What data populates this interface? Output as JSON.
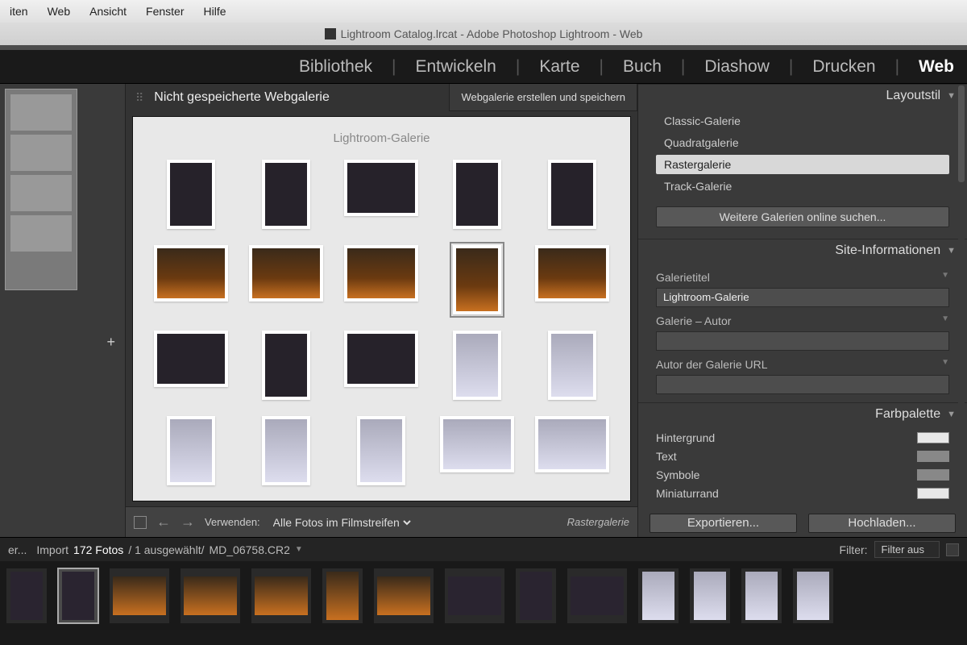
{
  "menubar": [
    "iten",
    "Web",
    "Ansicht",
    "Fenster",
    "Hilfe"
  ],
  "title": "Lightroom Catalog.lrcat - Adobe Photoshop Lightroom - Web",
  "modules": [
    "Bibliothek",
    "Entwickeln",
    "Karte",
    "Buch",
    "Diashow",
    "Drucken",
    "Web"
  ],
  "modules_active": "Web",
  "center": {
    "header_title": "Nicht gespeicherte Webgalerie",
    "save_btn": "Webgalerie erstellen und speichern",
    "gallery_title": "Lightroom-Galerie"
  },
  "thumbs": [
    {
      "o": "p",
      "cls": "dark"
    },
    {
      "o": "p",
      "cls": "dark"
    },
    {
      "o": "l",
      "cls": "dark"
    },
    {
      "o": "p",
      "cls": "dark"
    },
    {
      "o": "p",
      "cls": "dark"
    },
    {
      "o": "l",
      "cls": "fire"
    },
    {
      "o": "l",
      "cls": "fire"
    },
    {
      "o": "l",
      "cls": "fire"
    },
    {
      "o": "p",
      "cls": "fire",
      "sel": true
    },
    {
      "o": "l",
      "cls": "fire"
    },
    {
      "o": "l",
      "cls": "dark"
    },
    {
      "o": "p",
      "cls": "dark"
    },
    {
      "o": "l",
      "cls": "dark"
    },
    {
      "o": "p",
      "cls": "white"
    },
    {
      "o": "p",
      "cls": "white"
    },
    {
      "o": "p",
      "cls": "white"
    },
    {
      "o": "p",
      "cls": "white"
    },
    {
      "o": "p",
      "cls": "white"
    },
    {
      "o": "l",
      "cls": "white"
    },
    {
      "o": "l",
      "cls": "white"
    }
  ],
  "cbottom": {
    "verwenden": "Verwenden:",
    "select": "Alle Fotos im Filmstreifen",
    "rname": "Rastergalerie"
  },
  "right": {
    "layoutstil": {
      "title": "Layoutstil",
      "options": [
        "Classic-Galerie",
        "Quadratgalerie",
        "Rastergalerie",
        "Track-Galerie"
      ],
      "active": "Rastergalerie",
      "more": "Weitere Galerien online suchen..."
    },
    "siteinfo": {
      "title": "Site-Informationen",
      "galerie_label": "Galerietitel",
      "galerie_value": "Lightroom-Galerie",
      "autor_label": "Galerie – Autor",
      "autor_value": "",
      "url_label": "Autor der Galerie URL",
      "url_value": ""
    },
    "farbpalette": {
      "title": "Farbpalette",
      "rows": [
        {
          "label": "Hintergrund",
          "swatch": "light"
        },
        {
          "label": "Text",
          "swatch": "grey"
        },
        {
          "label": "Symbole",
          "swatch": "grey"
        },
        {
          "label": "Miniaturrand",
          "swatch": "light"
        }
      ]
    },
    "actions": {
      "export": "Exportieren...",
      "upload": "Hochladen..."
    }
  },
  "status": {
    "left_frag": "er...",
    "import": "Import",
    "fotos": "172 Fotos",
    "sel": "/ 1 ausgewählt/",
    "file": "MD_06758.CR2",
    "filter_label": "Filter:",
    "filter_value": "Filter aus"
  },
  "filmstrip": [
    {
      "o": "p",
      "cls": "fdark"
    },
    {
      "o": "p",
      "cls": "fdark",
      "sel": true
    },
    {
      "o": "l",
      "cls": "ffire"
    },
    {
      "o": "l",
      "cls": "ffire"
    },
    {
      "o": "l",
      "cls": "ffire"
    },
    {
      "o": "p",
      "cls": "ffire"
    },
    {
      "o": "l",
      "cls": "ffire"
    },
    {
      "o": "l",
      "cls": "fdark"
    },
    {
      "o": "p",
      "cls": "fdark"
    },
    {
      "o": "l",
      "cls": "fdark"
    },
    {
      "o": "p",
      "cls": "fwhite"
    },
    {
      "o": "p",
      "cls": "fwhite"
    },
    {
      "o": "p",
      "cls": "fwhite"
    },
    {
      "o": "p",
      "cls": "fwhite"
    }
  ]
}
